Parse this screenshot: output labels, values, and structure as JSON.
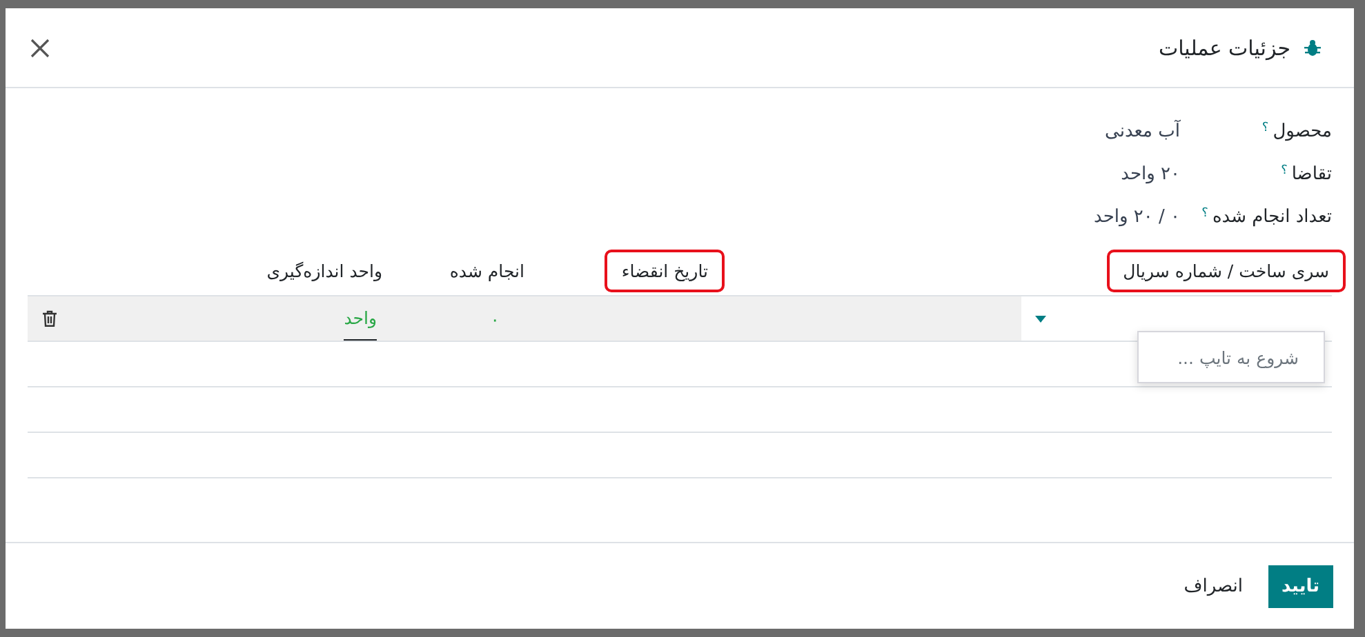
{
  "dialog": {
    "title": "جزئیات عملیات",
    "fields": [
      {
        "label": "محصول",
        "help": "؟",
        "value": "آب معدنی"
      },
      {
        "label": "تقاضا",
        "help": "؟",
        "value": "۲٠ واحد"
      },
      {
        "label": "تعداد انجام شده",
        "help": "؟",
        "value": "٠ / ۲٠ واحد"
      }
    ],
    "table": {
      "columns": [
        {
          "label": "سری ساخت / شماره سریال",
          "highlighted": true
        },
        {
          "label": "تاریخ انقضاء",
          "highlighted": true
        },
        {
          "label": "انجام شده",
          "highlighted": false
        },
        {
          "label": "واحد اندازه‌گیری",
          "highlighted": false
        }
      ],
      "rows": [
        {
          "done": "٠",
          "uom": "واحد"
        }
      ]
    },
    "autocomplete": {
      "hint": "شروع به تایپ ..."
    },
    "buttons": [
      {
        "label": "تایید",
        "kind": "primary"
      },
      {
        "label": "انصراف",
        "kind": "secondary"
      }
    ]
  }
}
